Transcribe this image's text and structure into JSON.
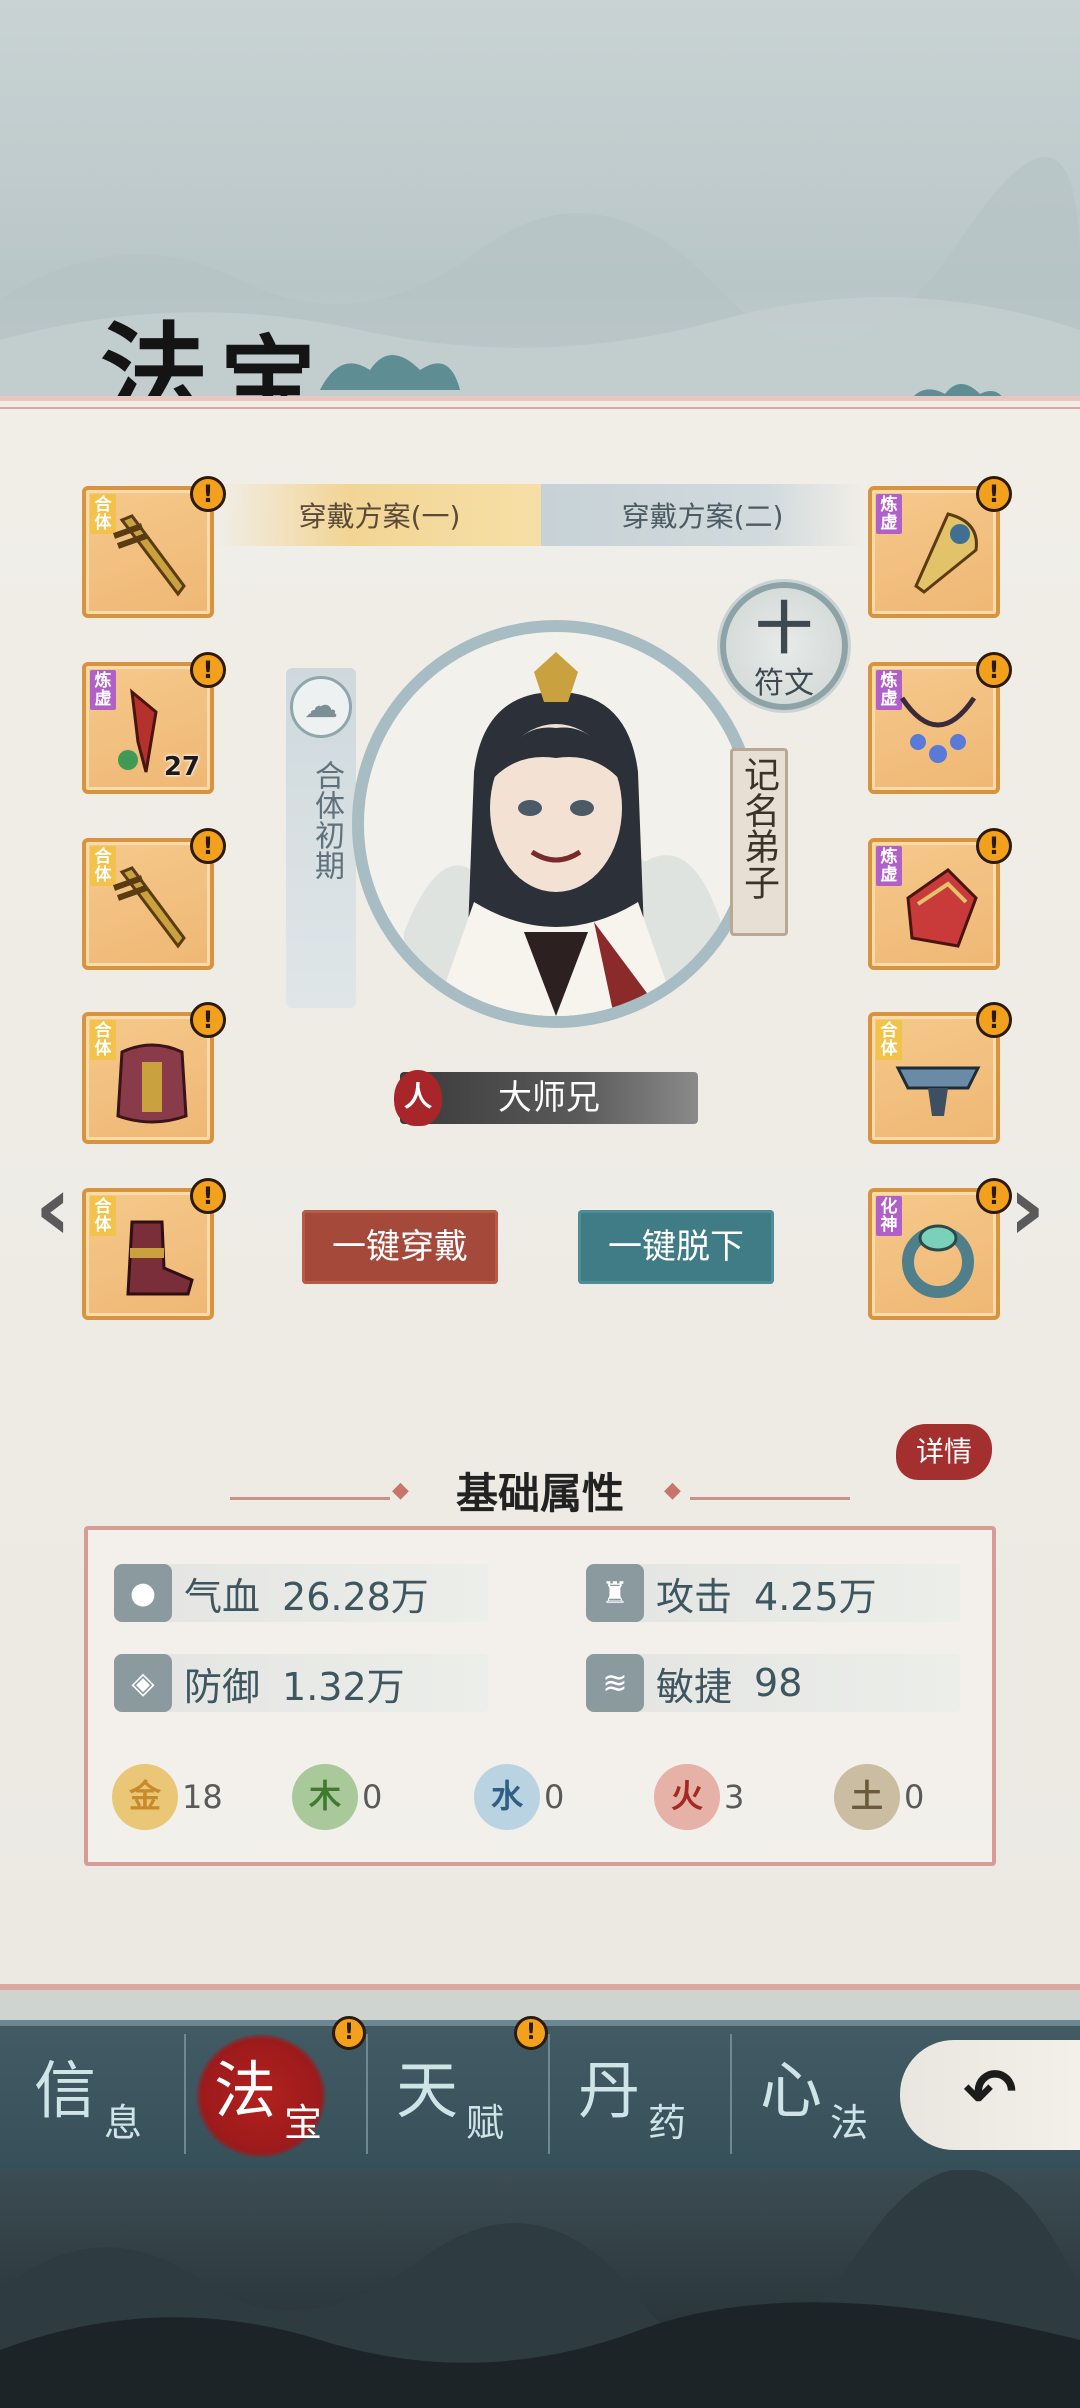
{
  "header": {
    "title_char_1": "法",
    "title_char_2": "宝"
  },
  "schemes": [
    {
      "label": "穿戴方案(一)",
      "active": true
    },
    {
      "label": "穿戴方案(二)",
      "active": false
    }
  ],
  "slots_left": [
    {
      "tag": "合体",
      "tag_color": "#f3c24a",
      "icon": "sword-icon",
      "alert": "!"
    },
    {
      "tag": "炼虚",
      "tag_color": "#b060c8",
      "icon": "red-blade-icon",
      "alert": "!",
      "count": "27"
    },
    {
      "tag": "合体",
      "tag_color": "#f3c24a",
      "icon": "sword-icon",
      "alert": "!"
    },
    {
      "tag": "合体",
      "tag_color": "#f3c24a",
      "icon": "armor-icon",
      "alert": "!"
    },
    {
      "tag": "合体",
      "tag_color": "#f3c24a",
      "icon": "boots-icon",
      "alert": "!"
    }
  ],
  "slots_right": [
    {
      "tag": "炼虚",
      "tag_color": "#b060c8",
      "icon": "fan-icon",
      "alert": "!"
    },
    {
      "tag": "炼虚",
      "tag_color": "#b060c8",
      "icon": "necklace-icon",
      "alert": "!"
    },
    {
      "tag": "炼虚",
      "tag_color": "#b060c8",
      "icon": "gem-icon",
      "alert": "!"
    },
    {
      "tag": "合体",
      "tag_color": "#f3c24a",
      "icon": "belt-icon",
      "alert": "!"
    },
    {
      "tag": "化神",
      "tag_color": "#b060c8",
      "icon": "ring-icon",
      "alert": "!"
    }
  ],
  "character": {
    "realm": "合体初期",
    "rank": "记名弟子",
    "race_seal": "人",
    "name": "大师兄"
  },
  "rune_button": {
    "plus": "十",
    "label": "符文"
  },
  "actions": {
    "equip_all": "一键穿戴",
    "unequip_all": "一键脱下"
  },
  "nav_arrows": {
    "left": "‹",
    "right": "›"
  },
  "attributes": {
    "detail_button": "详情",
    "heading": "基础属性",
    "stats": [
      {
        "label": "气血",
        "value": "26.28万",
        "icon": "blood-drop-icon"
      },
      {
        "label": "攻击",
        "value": "4.25万",
        "icon": "attack-icon"
      },
      {
        "label": "防御",
        "value": "1.32万",
        "icon": "shield-icon"
      },
      {
        "label": "敏捷",
        "value": "98",
        "icon": "wing-icon"
      }
    ],
    "elements": [
      {
        "glyph": "金",
        "value": "18",
        "bg": "#e9c777",
        "fg": "#d9a23a"
      },
      {
        "glyph": "木",
        "value": "0",
        "bg": "#a9c99a",
        "fg": "#4c8a3a"
      },
      {
        "glyph": "水",
        "value": "0",
        "bg": "#b9d3e3",
        "fg": "#3f6f94"
      },
      {
        "glyph": "火",
        "value": "3",
        "bg": "#e6b1a6",
        "fg": "#b2362b"
      },
      {
        "glyph": "土",
        "value": "0",
        "bg": "#cbbda1",
        "fg": "#7b6a4c"
      }
    ]
  },
  "bottom_nav": {
    "items": [
      {
        "big": "信",
        "small": "息",
        "active": false
      },
      {
        "big": "法",
        "small": "宝",
        "active": true
      },
      {
        "big": "天",
        "small": "赋",
        "active": false
      },
      {
        "big": "丹",
        "small": "药",
        "active": false
      },
      {
        "big": "心",
        "small": "法",
        "active": false
      }
    ],
    "alert": "!",
    "back_glyph": "↶"
  },
  "colors": {
    "slot_border": "#d9933f",
    "equip_btn": "#a54a3a",
    "unequip_btn": "#3f7c86",
    "accent_red": "#a3302e"
  }
}
